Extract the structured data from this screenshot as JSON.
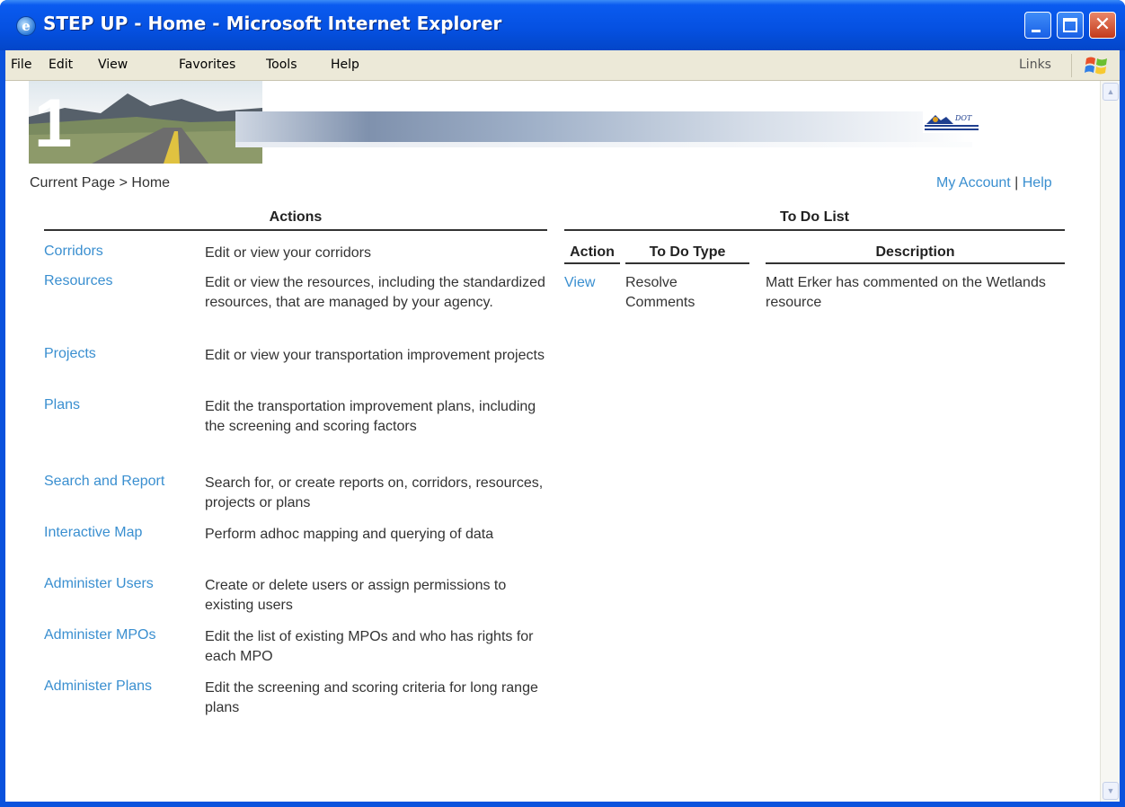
{
  "window": {
    "title": "STEP UP - Home - Microsoft Internet Explorer",
    "icon": "ie-icon",
    "min_label": "minimize",
    "max_label": "maximize",
    "close_glyph": "✕"
  },
  "menu": {
    "items": [
      "File",
      "Edit",
      "View",
      "Favorites",
      "Tools",
      "Help"
    ],
    "links_label": "Links"
  },
  "banner": {
    "number": "1",
    "logo_text": "DOT"
  },
  "breadcrumb": "Current Page > Home",
  "account": {
    "my_account": "My Account",
    "separator": " | ",
    "help": "Help"
  },
  "actions": {
    "title": "Actions",
    "items": [
      {
        "label": "Corridors",
        "desc": "Edit or view your corridors"
      },
      {
        "label": "Resources",
        "desc": "Edit or view the resources, including the standardized resources, that are managed by your agency."
      },
      {
        "label": "Projects",
        "desc": "Edit or view your transportation improvement projects"
      },
      {
        "label": "Plans",
        "desc": "Edit the transportation improvement plans, including the screening and scoring factors"
      },
      {
        "label": "Search and Report",
        "desc": "Search for, or create reports on, corridors, resources, projects or plans"
      },
      {
        "label": "Interactive Map",
        "desc": "Perform adhoc mapping and querying of data"
      },
      {
        "label": "Administer Users",
        "desc": "Create or delete users or assign permissions to existing users"
      },
      {
        "label": "Administer MPOs",
        "desc": "Edit the list of existing MPOs and who has rights for each MPO"
      },
      {
        "label": "Administer Plans",
        "desc": "Edit the screening and scoring criteria for long range plans"
      }
    ]
  },
  "todo": {
    "title": "To Do List",
    "columns": [
      "Action",
      "To Do Type",
      "Description"
    ],
    "rows": [
      {
        "action": "View",
        "type": "Resolve Comments",
        "description": "Matt Erker has commented on the Wetlands resource"
      }
    ]
  },
  "colors": {
    "link": "#3a8fd0",
    "titlebar": "#0550e0",
    "menubar": "#ece9d8"
  }
}
